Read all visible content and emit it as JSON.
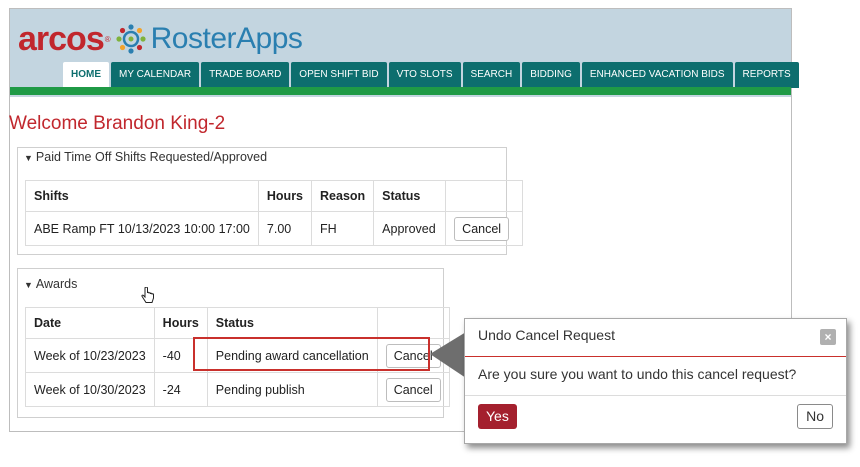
{
  "brand": {
    "arcos": "arcos",
    "reg": "®",
    "roster": "RosterApps"
  },
  "nav": {
    "tabs": [
      {
        "label": "HOME"
      },
      {
        "label": "MY CALENDAR"
      },
      {
        "label": "TRADE BOARD"
      },
      {
        "label": "OPEN SHIFT BID"
      },
      {
        "label": "VTO SLOTS"
      },
      {
        "label": "SEARCH"
      },
      {
        "label": "BIDDING"
      },
      {
        "label": "ENHANCED VACATION BIDS"
      },
      {
        "label": "REPORTS"
      }
    ]
  },
  "welcome": "Welcome Brandon King-2",
  "pto": {
    "title": "Paid Time Off Shifts Requested/Approved",
    "headers": {
      "shifts": "Shifts",
      "hours": "Hours",
      "reason": "Reason",
      "status": "Status"
    },
    "rows": [
      {
        "shift": "ABE Ramp FT 10/13/2023 10:00 17:00",
        "hours": "7.00",
        "reason": "FH",
        "status": "Approved",
        "action": "Cancel"
      }
    ]
  },
  "awards": {
    "title": "Awards",
    "headers": {
      "date": "Date",
      "hours": "Hours",
      "status": "Status"
    },
    "rows": [
      {
        "date": "Week of 10/23/2023",
        "hours": "-40",
        "status": "Pending award cancellation",
        "action": "Cancel"
      },
      {
        "date": "Week of 10/30/2023",
        "hours": "-24",
        "status": "Pending publish",
        "action": "Cancel"
      }
    ]
  },
  "dialog": {
    "title": "Undo Cancel Request",
    "close": "×",
    "message": "Are you sure you want to undo this cancel request?",
    "yes": "Yes",
    "no": "No"
  },
  "colors": {
    "brand_red": "#c1272d",
    "nav_teal": "#0d6e6e",
    "green_bar": "#1f9a46",
    "header_bg": "#c3d5e0",
    "yes_btn": "#a4202e"
  },
  "icons": {
    "caret": "caret-down-icon",
    "pointer": "hand-pointer-icon",
    "close": "close-icon"
  }
}
